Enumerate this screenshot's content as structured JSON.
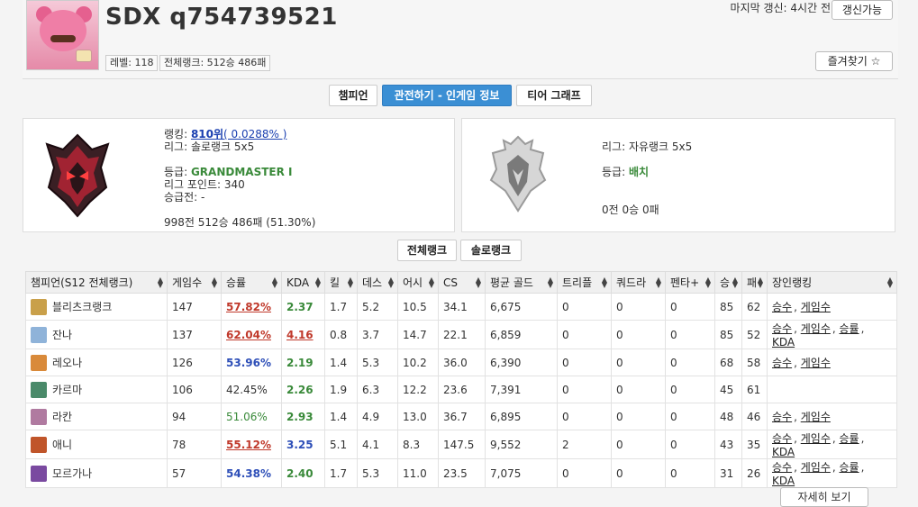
{
  "profile": {
    "name": "SDX q754739521",
    "level_badge": "레벨: 118",
    "rank_badge": "전체랭크: 512승 486패",
    "last_update": "마지막 갱신: 4시간 전",
    "refresh_label": "갱신가능",
    "favorite_label": "즐겨찾기 ☆"
  },
  "tabs": [
    {
      "label": "챔피언"
    },
    {
      "label": "관전하기 - 인게임 정보"
    },
    {
      "label": "티어 그래프"
    }
  ],
  "solo": {
    "ranking_label": "랭킹: ",
    "ranking_value": "810위",
    "ranking_pct": "( 0.0288% )",
    "league": "리그: 솔로랭크 5x5",
    "tier_label": "등급: ",
    "tier_value": "GRANDMASTER I",
    "points": "리그 포인트: 340",
    "promo": "승급전: -",
    "record": "998전 512승 486패 (51.30%)"
  },
  "flex": {
    "league": "리그: 자유랭크 5x5",
    "tier_label": "등급: ",
    "tier_value": "배치",
    "record": "0전 0승 0패"
  },
  "rank_tabs": [
    {
      "label": "전체랭크"
    },
    {
      "label": "솔로랭크"
    }
  ],
  "table": {
    "headers": [
      "챔피언(S12 전체랭크)",
      "게임수",
      "승률",
      "KDA",
      "킬",
      "데스",
      "어시",
      "CS",
      "평균 골드",
      "트리플",
      "쿼드라",
      "펜타+",
      "승",
      "패",
      "장인랭킹"
    ],
    "rows": [
      {
        "name": "블리츠크랭크",
        "games": "147",
        "winrate": "57.82%",
        "wr_style": "red",
        "kda": "2.37",
        "kda_style": "green",
        "kill": "1.7",
        "death": "5.2",
        "assist": "10.5",
        "cs": "34.1",
        "gold": "6,675",
        "triple": "0",
        "quadra": "0",
        "penta": "0",
        "win": "85",
        "loss": "62",
        "ranking": [
          "승수",
          "게임수"
        ],
        "icon_color": "#c9a04a"
      },
      {
        "name": "잔나",
        "games": "137",
        "winrate": "62.04%",
        "wr_style": "red",
        "kda": "4.16",
        "kda_style": "red",
        "kill": "0.8",
        "death": "3.7",
        "assist": "14.7",
        "cs": "22.1",
        "gold": "6,859",
        "triple": "0",
        "quadra": "0",
        "penta": "0",
        "win": "85",
        "loss": "52",
        "ranking": [
          "승수",
          "게임수",
          "승률",
          "KDA"
        ],
        "icon_color": "#8fb3d9"
      },
      {
        "name": "레오나",
        "games": "126",
        "winrate": "53.96%",
        "wr_style": "blue",
        "kda": "2.19",
        "kda_style": "green",
        "kill": "1.4",
        "death": "5.3",
        "assist": "10.2",
        "cs": "36.0",
        "gold": "6,390",
        "triple": "0",
        "quadra": "0",
        "penta": "0",
        "win": "68",
        "loss": "58",
        "ranking": [
          "승수",
          "게임수"
        ],
        "icon_color": "#d98a3a"
      },
      {
        "name": "카르마",
        "games": "106",
        "winrate": "42.45%",
        "wr_style": "plain",
        "kda": "2.26",
        "kda_style": "green",
        "kill": "1.9",
        "death": "6.3",
        "assist": "12.2",
        "cs": "23.6",
        "gold": "7,391",
        "triple": "0",
        "quadra": "0",
        "penta": "0",
        "win": "45",
        "loss": "61",
        "ranking": [],
        "icon_color": "#4a8a6a"
      },
      {
        "name": "라칸",
        "games": "94",
        "winrate": "51.06%",
        "wr_style": "green",
        "kda": "2.93",
        "kda_style": "green",
        "kill": "1.4",
        "death": "4.9",
        "assist": "13.0",
        "cs": "36.7",
        "gold": "6,895",
        "triple": "0",
        "quadra": "0",
        "penta": "0",
        "win": "48",
        "loss": "46",
        "ranking": [
          "승수",
          "게임수"
        ],
        "icon_color": "#b07aa0"
      },
      {
        "name": "애니",
        "games": "78",
        "winrate": "55.12%",
        "wr_style": "red",
        "kda": "3.25",
        "kda_style": "blue",
        "kill": "5.1",
        "death": "4.1",
        "assist": "8.3",
        "cs": "147.5",
        "gold": "9,552",
        "triple": "2",
        "quadra": "0",
        "penta": "0",
        "win": "43",
        "loss": "35",
        "ranking": [
          "승수",
          "게임수",
          "승률",
          "KDA"
        ],
        "icon_color": "#c0552a"
      },
      {
        "name": "모르가나",
        "games": "57",
        "winrate": "54.38%",
        "wr_style": "blue",
        "kda": "2.40",
        "kda_style": "green",
        "kill": "1.7",
        "death": "5.3",
        "assist": "11.0",
        "cs": "23.5",
        "gold": "7,075",
        "triple": "0",
        "quadra": "0",
        "penta": "0",
        "win": "31",
        "loss": "26",
        "ranking": [
          "승수",
          "게임수",
          "승률",
          "KDA"
        ],
        "icon_color": "#7a4aa0"
      }
    ]
  },
  "bottom_button": "자세히 보기"
}
